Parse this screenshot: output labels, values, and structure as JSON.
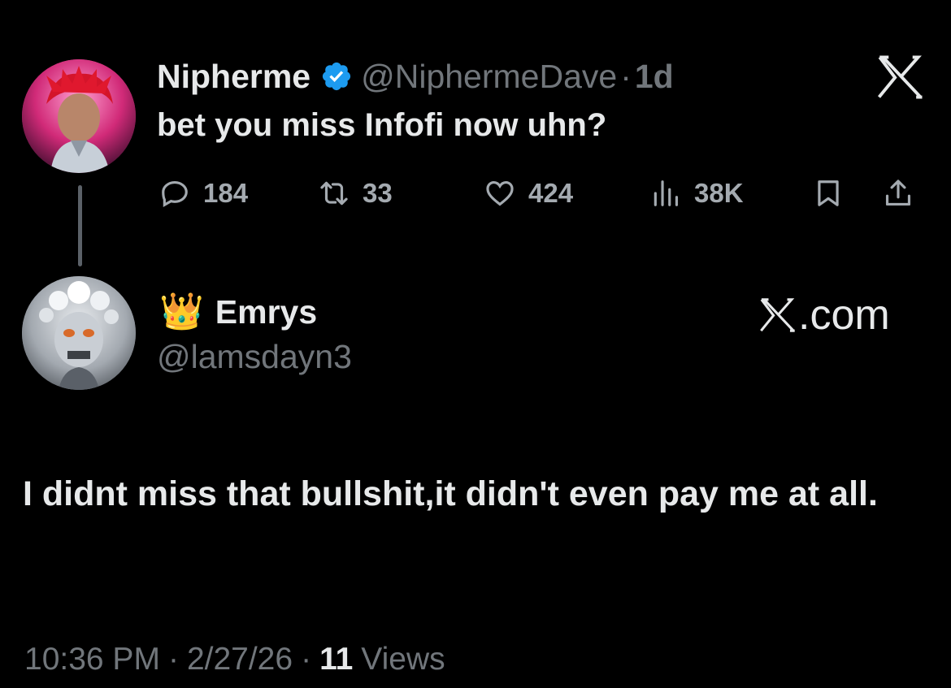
{
  "parent_tweet": {
    "display_name": "Nipherme",
    "verified": true,
    "handle": "@NiphermeDave",
    "separator": "·",
    "time": "1d",
    "text": "bet you miss Infofi now uhn?",
    "actions": {
      "replies": "184",
      "reposts": "33",
      "likes": "424",
      "views": "38K"
    },
    "avatar_icon": "avatar-red-hair-anime",
    "platform_icon": "x-logo"
  },
  "reply": {
    "crown_emoji": "👑",
    "display_name": "Emrys",
    "handle": "@lamsdayn3",
    "watermark": ".com",
    "text": "I didnt miss that bullshit,it didn't even pay me at all.",
    "avatar_icon": "avatar-skull-flowers"
  },
  "footer": {
    "time": "10:36 PM",
    "separator": "·",
    "date": "2/27/26",
    "views_count": "11",
    "views_label": "Views"
  },
  "colors": {
    "background": "#000000",
    "primary_text": "#e7e9ea",
    "secondary_text": "#71767b",
    "verified_blue": "#1d9bf0"
  }
}
